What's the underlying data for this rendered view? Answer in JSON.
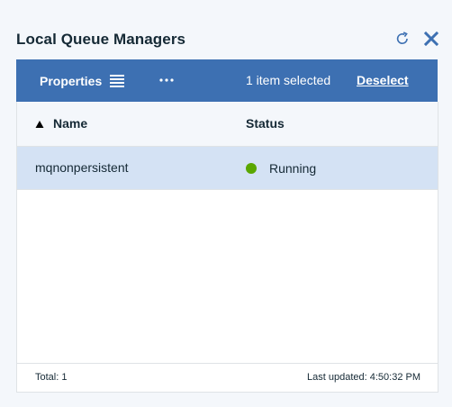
{
  "widget": {
    "title": "Local Queue Managers",
    "icons": {
      "refresh": "refresh-icon",
      "close": "close-icon"
    }
  },
  "toolbar": {
    "properties_label": "Properties",
    "list_icon": "list-icon",
    "more_icon": "overflow-menu-icon",
    "selected_text": "1 item selected",
    "deselect_label": "Deselect"
  },
  "table": {
    "columns": [
      {
        "label": "Name",
        "sort": "ascending"
      },
      {
        "label": "Status"
      }
    ],
    "rows": [
      {
        "name": "mqnonpersistent",
        "status": "Running",
        "selected": true
      }
    ]
  },
  "footer": {
    "total": "Total: 1",
    "last_updated": "Last updated: 4:50:32 PM"
  },
  "colors": {
    "toolbar_bg": "#3d70b2",
    "selected_row_bg": "#d4e2f4",
    "status_running": "#5aa700",
    "icon_blue": "#3d70b2",
    "page_bg": "#f4f7fb"
  }
}
